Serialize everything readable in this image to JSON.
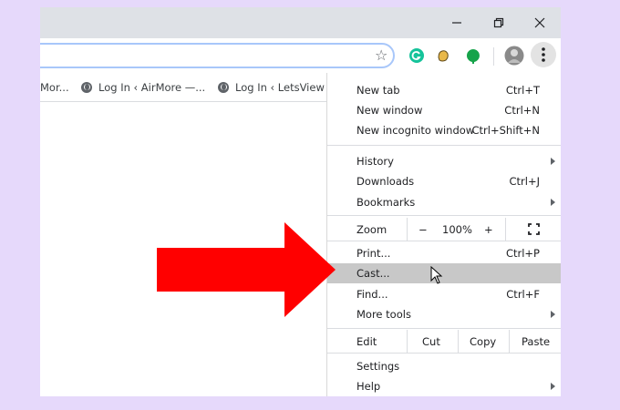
{
  "window": {
    "minimize_icon": "minimize-icon",
    "restore_icon": "restore-icon",
    "close_icon": "close-icon"
  },
  "toolbar": {
    "star_icon": "bookmark-star-icon",
    "extensions": [
      "grammarly-icon",
      "extension-hand-icon",
      "extension-green-icon"
    ],
    "avatar": "profile-avatar",
    "menu_icon": "kebab-menu-icon"
  },
  "bookmarks": [
    {
      "label": "Mor..."
    },
    {
      "label": "Log In ‹ AirMore —..."
    },
    {
      "label": "Log In ‹ LetsView –"
    }
  ],
  "menu": {
    "new_tab": {
      "label": "New tab",
      "shortcut": "Ctrl+T"
    },
    "new_window": {
      "label": "New window",
      "shortcut": "Ctrl+N"
    },
    "new_incognito": {
      "label": "New incognito window",
      "shortcut": "Ctrl+Shift+N"
    },
    "history": {
      "label": "History"
    },
    "downloads": {
      "label": "Downloads",
      "shortcut": "Ctrl+J"
    },
    "bookmarks": {
      "label": "Bookmarks"
    },
    "zoom": {
      "label": "Zoom",
      "minus": "−",
      "value": "100%",
      "plus": "+"
    },
    "print": {
      "label": "Print...",
      "shortcut": "Ctrl+P"
    },
    "cast": {
      "label": "Cast..."
    },
    "find": {
      "label": "Find...",
      "shortcut": "Ctrl+F"
    },
    "more_tools": {
      "label": "More tools"
    },
    "edit": {
      "label": "Edit",
      "cut": "Cut",
      "copy": "Copy",
      "paste": "Paste"
    },
    "settings": {
      "label": "Settings"
    },
    "help": {
      "label": "Help"
    }
  },
  "annotation": {
    "arrow_color": "#ff0000"
  }
}
